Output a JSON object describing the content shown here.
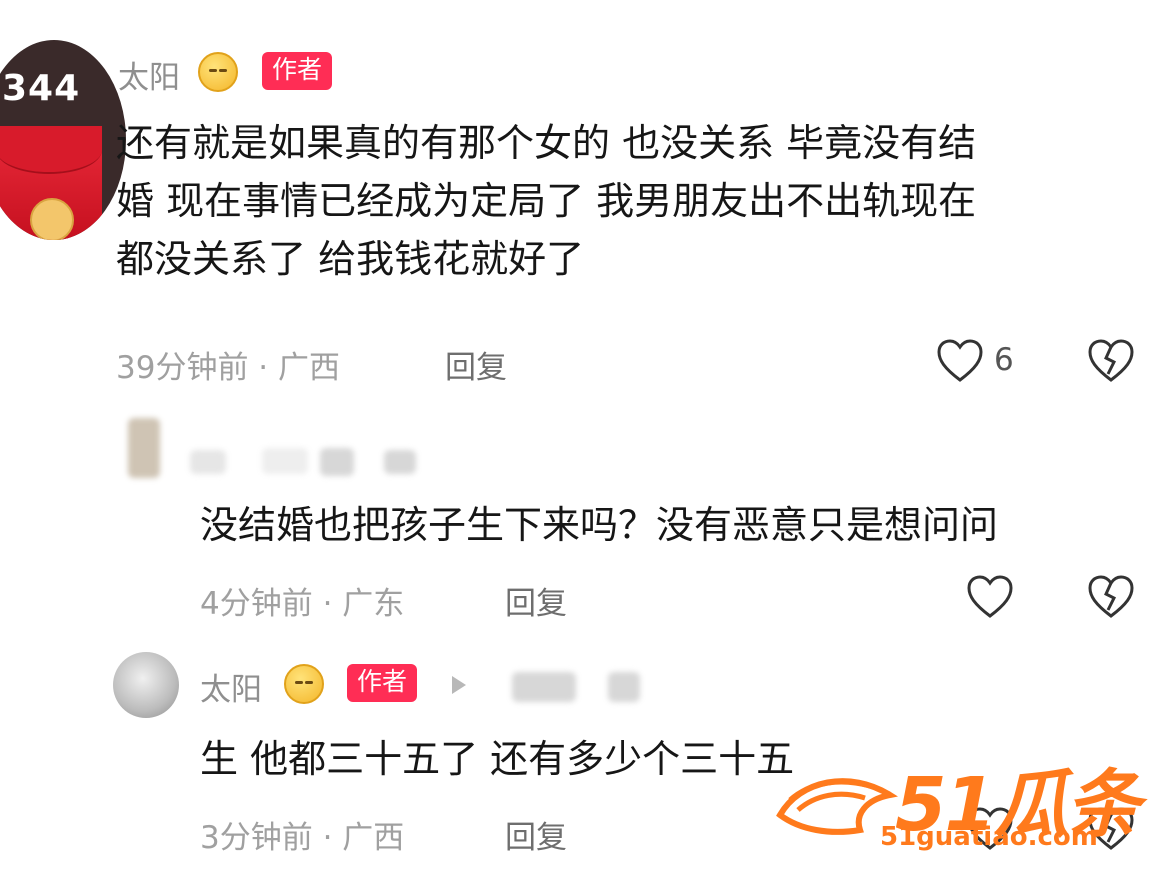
{
  "comments": [
    {
      "avatar_badge": "344",
      "username": "太阳",
      "author_tag": "作者",
      "text_lines": [
        "还有就是如果真的有那个女的 也没关系 毕竟没有结",
        "婚 现在事情已经成为定局了 我男朋友出不出轨现在",
        "都没关系了 给我钱花就好了"
      ],
      "meta": "39分钟前 · 广西",
      "reply_label": "回复",
      "like_count": "6"
    },
    {
      "text": "没结婚也把孩子生下来吗？没有恶意只是想问问",
      "meta": "4分钟前 · 广东",
      "reply_label": "回复"
    },
    {
      "username": "太阳",
      "author_tag": "作者",
      "text": "生 他都三十五了 还有多少个三十五",
      "meta": "3分钟前 · 广西",
      "reply_label": "回复"
    }
  ],
  "watermark": {
    "brand": "51瓜条",
    "url": "51guatiao.com",
    "color": "#ff7a1c"
  },
  "icons": {
    "like": "heart-icon",
    "dislike": "broken-heart-icon",
    "emoji": "sun-emoji-icon"
  }
}
